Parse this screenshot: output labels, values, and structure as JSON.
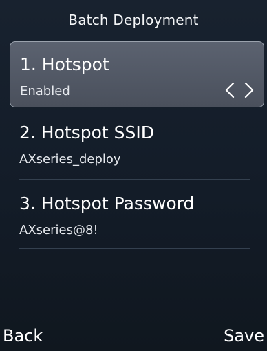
{
  "header": {
    "title": "Batch Deployment"
  },
  "items": [
    {
      "label": "1. Hotspot",
      "value": "Enabled",
      "selected": true
    },
    {
      "label": "2. Hotspot SSID",
      "value": "AXseries_deploy",
      "selected": false
    },
    {
      "label": "3. Hotspot Password",
      "value": "AXseries@8!",
      "selected": false
    }
  ],
  "softkeys": {
    "left": "Back",
    "right": "Save"
  },
  "icons": {
    "prev": "chevron-left-icon",
    "next": "chevron-right-icon"
  },
  "colors": {
    "background": "#131d2a",
    "selected_fill": "#545b67",
    "selected_border": "#9aa2ad",
    "text": "#ffffff"
  }
}
